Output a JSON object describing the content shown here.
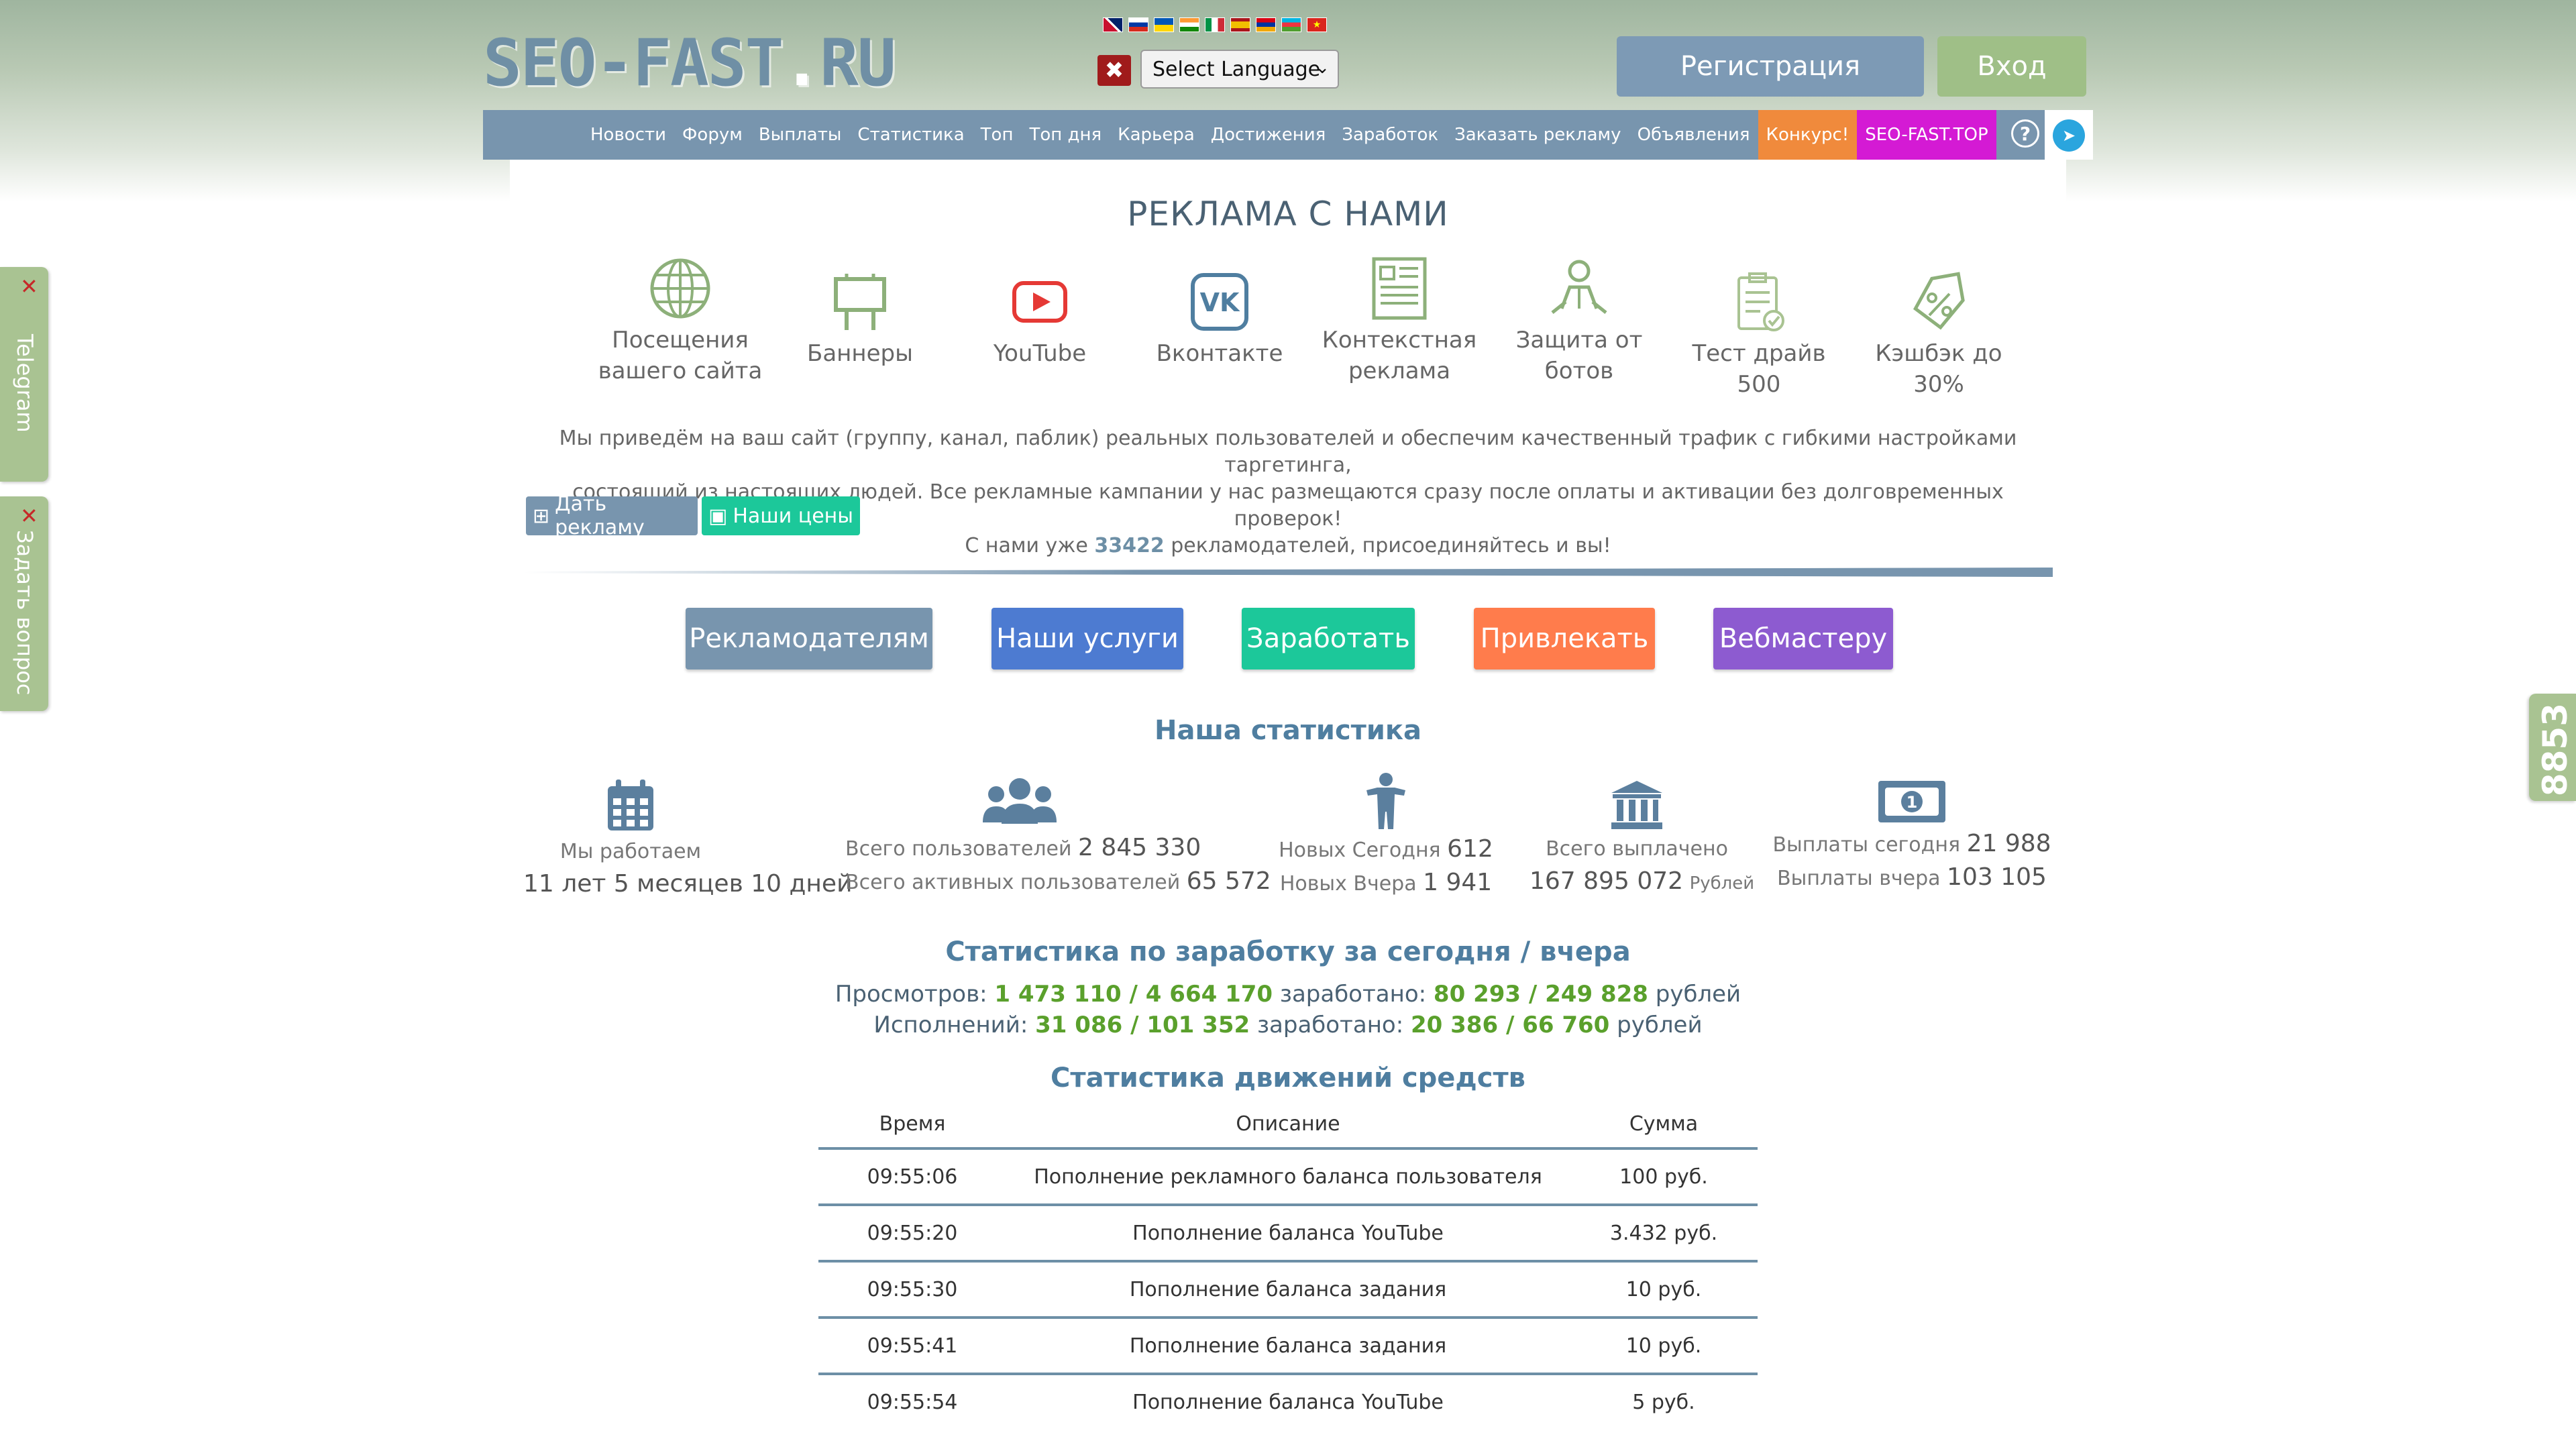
{
  "header": {
    "logo_main": "SEO-FAST",
    "logo_dot": ".",
    "logo_tld": "RU",
    "language_select": "Select Language",
    "register_label": "Регистрация",
    "login_label": "Вход"
  },
  "nav": {
    "items": [
      "Новости",
      "Форум",
      "Выплаты",
      "Статистика",
      "Топ",
      "Топ дня",
      "Карьера",
      "Достижения",
      "Заработок",
      "Заказать рекламу",
      "Объявления"
    ],
    "contest": "Конкурс!",
    "top_site": "SEO-FAST.TOP",
    "help_icon": "question-circle-icon",
    "telegram_icon": "telegram-icon"
  },
  "ads": {
    "title": "РЕКЛАМА С НАМИ",
    "features": [
      {
        "icon": "globe-icon",
        "line1": "Посещения",
        "line2": "вашего сайта",
        "color": "#8db07a"
      },
      {
        "icon": "billboard-icon",
        "line1": "Баннеры",
        "line2": "",
        "color": "#8db07a"
      },
      {
        "icon": "youtube-icon",
        "line1": "YouTube",
        "line2": "",
        "color": "#e53935"
      },
      {
        "icon": "vk-icon",
        "line1": "Вконтакте",
        "line2": "",
        "color": "#4f7ea0"
      },
      {
        "icon": "document-icon",
        "line1": "Контекстная",
        "line2": "реклама",
        "color": "#8db07a"
      },
      {
        "icon": "bot-protect-icon",
        "line1": "Защита от",
        "line2": "ботов",
        "color": "#8db07a"
      },
      {
        "icon": "clipboard-check-icon",
        "line1": "Тест драйв 500",
        "line2": "",
        "color": "#8db07a"
      },
      {
        "icon": "cashback-tag-icon",
        "line1": "Кэшбэк до 30%",
        "line2": "",
        "color": "#8db07a"
      }
    ],
    "desc_line1": "Мы приведём на ваш сайт (группу, канал, паблик) реальных пользователей и обеспечим качественный трафик с гибкими настройками таргетинга,",
    "desc_line2": "состоящий из настоящих людей. Все рекламные кампании у нас размещаются сразу после оплаты и активации без долговременных проверок!",
    "desc_prefix": "С нами уже",
    "advertisers_count": "33422",
    "desc_suffix": "рекламодателей, присоединяйтесь и вы!",
    "give_ad_label": "Дать рекламу",
    "prices_label": "Наши цены"
  },
  "categories": [
    {
      "label": "Рекламодателям",
      "color": "#7895ae"
    },
    {
      "label": "Наши услуги",
      "color": "#4d7bd1"
    },
    {
      "label": "Заработать",
      "color": "#1cc89a"
    },
    {
      "label": "Привлекать",
      "color": "#ff7c4c"
    },
    {
      "label": "Вебмастеру",
      "color": "#8d5bd0"
    }
  ],
  "stats": {
    "title": "Наша статистика",
    "working_label": "Мы работаем",
    "working_value": "11 лет 5 месяцев 10 дней",
    "users_total_label": "Всего пользователей",
    "users_total": "2 845 330",
    "users_active_label": "Всего активных пользователей",
    "users_active": "65 572",
    "new_today_label": "Новых Сегодня",
    "new_today": "612",
    "new_yesterday_label": "Новых Вчера",
    "new_yesterday": "1 941",
    "paid_total_label": "Всего выплачено",
    "paid_total": "167 895 072",
    "paid_currency": "Рублей",
    "payouts_today_label": "Выплаты сегодня",
    "payouts_today": "21 988",
    "payouts_yesterday_label": "Выплаты вчера",
    "payouts_yesterday": "103 105"
  },
  "earnings": {
    "title": "Статистика по заработку за сегодня / вчера",
    "views_label": "Просмотров:",
    "views_value": "1 473 110 / 4 664 170",
    "views_earned_label": "заработано:",
    "views_earned": "80 293 / 249 828",
    "currency": "рублей",
    "tasks_label": "Исполнений:",
    "tasks_value": "31 086 / 101 352",
    "tasks_earned_label": "заработано:",
    "tasks_earned": "20 386 / 66 760"
  },
  "movements": {
    "title": "Статистика движений средств",
    "headers": [
      "Время",
      "Описание",
      "Сумма"
    ],
    "rows": [
      [
        "09:55:06",
        "Пополнение рекламного баланса пользователя",
        "100 руб."
      ],
      [
        "09:55:20",
        "Пополнение баланса YouTube",
        "3.432 руб."
      ],
      [
        "09:55:30",
        "Пополнение баланса задания",
        "10 руб."
      ],
      [
        "09:55:41",
        "Пополнение баланса задания",
        "10 руб."
      ],
      [
        "09:55:54",
        "Пополнение баланса YouTube",
        "5 руб."
      ]
    ]
  },
  "side": {
    "telegram_label": "Telegram",
    "ask_label": "Задать вопрос",
    "online_count": "8853"
  }
}
